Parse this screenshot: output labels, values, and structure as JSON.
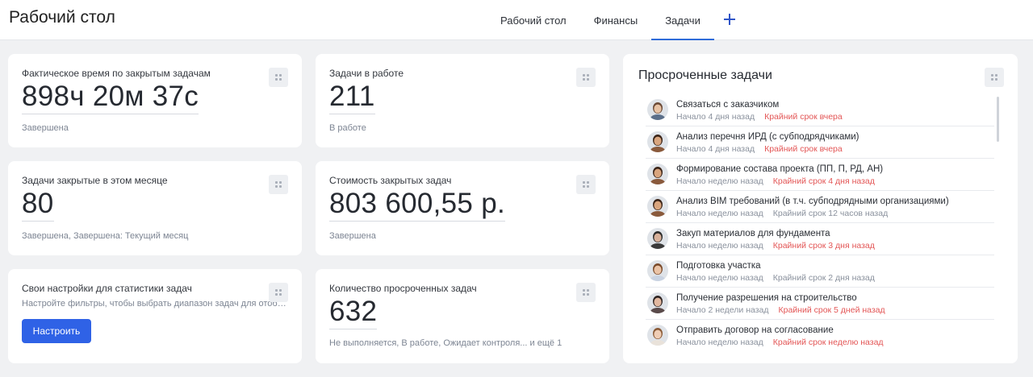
{
  "header": {
    "title": "Рабочий стол",
    "tabs": [
      {
        "label": "Рабочий стол"
      },
      {
        "label": "Финансы"
      },
      {
        "label": "Задачи"
      }
    ],
    "active_tab": "Задачи",
    "add_tab_icon": "plus-icon"
  },
  "widgets": {
    "actual_time": {
      "title": "Фактическое время по закрытым задачам",
      "value": "898ч 20м 37с",
      "note": "Завершена"
    },
    "in_progress": {
      "title": "Задачи в работе",
      "value": "211",
      "note": "В работе"
    },
    "closed_this_month": {
      "title": "Задачи закрытые в этом месяце",
      "value": "80",
      "note": "Завершена, Завершена: Текущий месяц"
    },
    "closed_cost": {
      "title": "Стоимость закрытых задач",
      "value": "803 600,55 р.",
      "note": "Завершена"
    },
    "custom_settings": {
      "title": "Свои настройки для статистики задач",
      "description": "Настройте фильтры, чтобы выбрать диапазон задач для отображения статистики",
      "button_label": "Настроить"
    },
    "overdue_count": {
      "title": "Количество просроченных задач",
      "value": "632",
      "note": "Не выполняется, В работе, Ожидает контроля... и ещё 1"
    }
  },
  "overdue_panel": {
    "title": "Просроченные задачи",
    "tasks": [
      {
        "name": "Связаться с заказчиком",
        "start": "Начало 4 дня назад",
        "due": "Крайний срок вчера",
        "due_overdue": true,
        "avatar": {
          "skin": "#e7c2a4",
          "hair": "#6b4a36",
          "shirt": "#5b6f8a"
        }
      },
      {
        "name": "Анализ перечня ИРД (с субподрядчиками)",
        "start": "Начало 4 дня назад",
        "due": "Крайний срок вчера",
        "due_overdue": true,
        "avatar": {
          "skin": "#d9a57e",
          "hair": "#3a2418",
          "shirt": "#8a5a3c"
        }
      },
      {
        "name": "Формирование состава проекта (ПП, П, РД, АН)",
        "start": "Начало неделю назад",
        "due": "Крайний срок 4 дня назад",
        "due_overdue": true,
        "avatar": {
          "skin": "#d9a57e",
          "hair": "#3a2418",
          "shirt": "#8a5a3c"
        }
      },
      {
        "name": "Анализ BIM требований (в т.ч. субподрядными организациями)",
        "start": "Начало неделю назад",
        "due": "Крайний срок 12 часов назад",
        "due_overdue": false,
        "avatar": {
          "skin": "#d9a57e",
          "hair": "#3a2418",
          "shirt": "#8a5a3c"
        }
      },
      {
        "name": "Закуп материалов для фундамента",
        "start": "Начало неделю назад",
        "due": "Крайний срок 3 дня назад",
        "due_overdue": true,
        "avatar": {
          "skin": "#d7b09a",
          "hair": "#2b2b2b",
          "shirt": "#3a3a3a"
        }
      },
      {
        "name": "Подготовка участка",
        "start": "Начало неделю назад",
        "due": "Крайний срок 2 дня назад",
        "due_overdue": false,
        "avatar": {
          "skin": "#eac3a6",
          "hair": "#7a4a2a",
          "shirt": "#c9d3e2"
        }
      },
      {
        "name": "Получение разрешения на строительство",
        "start": "Начало 2 недели назад",
        "due": "Крайний срок 5 дней назад",
        "due_overdue": true,
        "avatar": {
          "skin": "#e2b8a0",
          "hair": "#2d2422",
          "shirt": "#5a4a4a"
        }
      },
      {
        "name": "Отправить договор на согласование",
        "start": "Начало неделю назад",
        "due": "Крайний срок неделю назад",
        "due_overdue": true,
        "avatar": {
          "skin": "#efcdb5",
          "hair": "#8a5a36",
          "shirt": "#e9e2da"
        }
      }
    ]
  },
  "icons": {
    "drag_handle": "drag-handle-icon",
    "add_tab": "plus-icon"
  },
  "colors": {
    "accent": "#2f62e6",
    "tab_underline": "#2f6cd9",
    "overdue": "#e35656",
    "muted": "#8a919d",
    "background": "#f0f1f3"
  }
}
